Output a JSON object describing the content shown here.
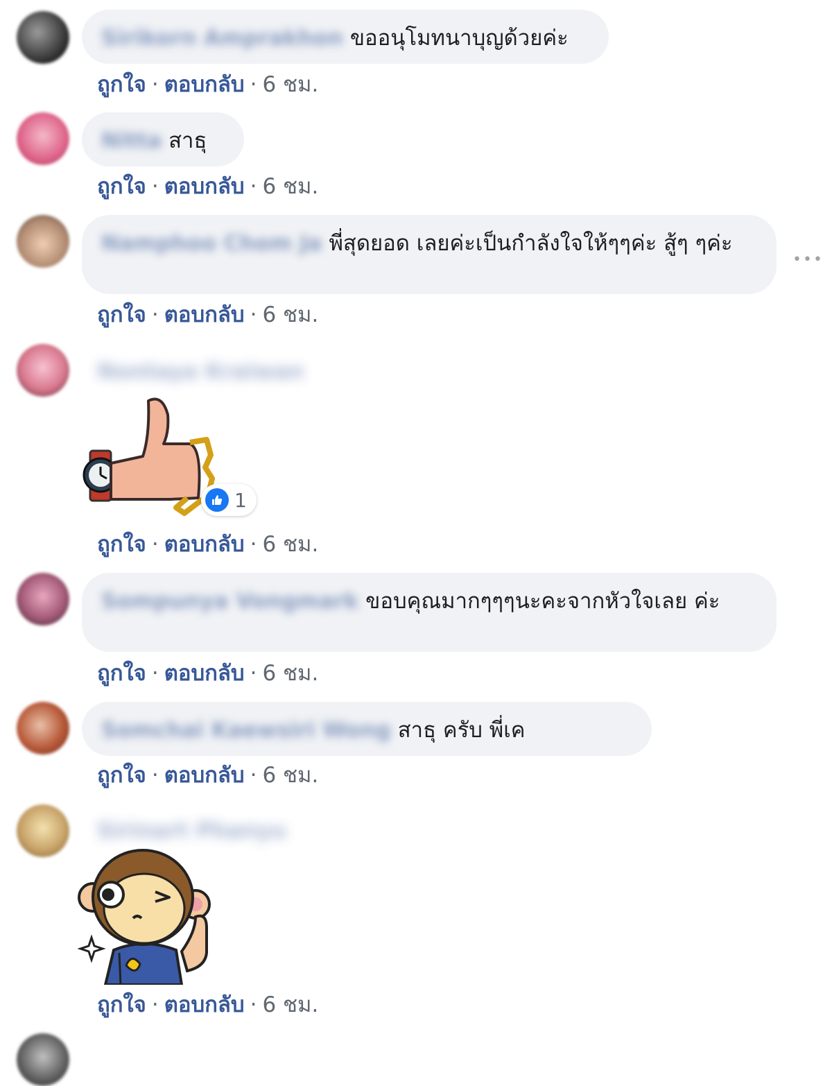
{
  "actions": {
    "like": "ถูกใจ",
    "reply": "ตอบกลับ",
    "separator": "·",
    "time": "6 ชม."
  },
  "more_icon": "•••",
  "comments": [
    {
      "name": "Sirikorn Amprakhon",
      "text": "ขออนุโมทนาบุญด้วยค่ะ"
    },
    {
      "name": "Nitta",
      "text": "สาธุ"
    },
    {
      "name": "Namphoo Chom Ja",
      "text": "พี่สุดยอด เลยค่ะเป็นกำลังใจให้ๆๆค่ะ สู้ๆ ๆค่ะ"
    },
    {
      "name": "Nontaya Kraiwan",
      "sticker": "thumbs-up-watch-sticker",
      "reactions": {
        "icon": "like-icon",
        "count": "1"
      }
    },
    {
      "name": "Sompunya Vongmark",
      "text": "ขอบคุณมากๆๆๆนะคะจากหัวใจเลย ค่ะ"
    },
    {
      "name": "Somchai Kaewsiri Wong",
      "text": "สาธุ ครับ พี่เค"
    },
    {
      "name": "Sirinart Phanyu",
      "sticker": "monkey-thumbs-up-sticker"
    }
  ]
}
